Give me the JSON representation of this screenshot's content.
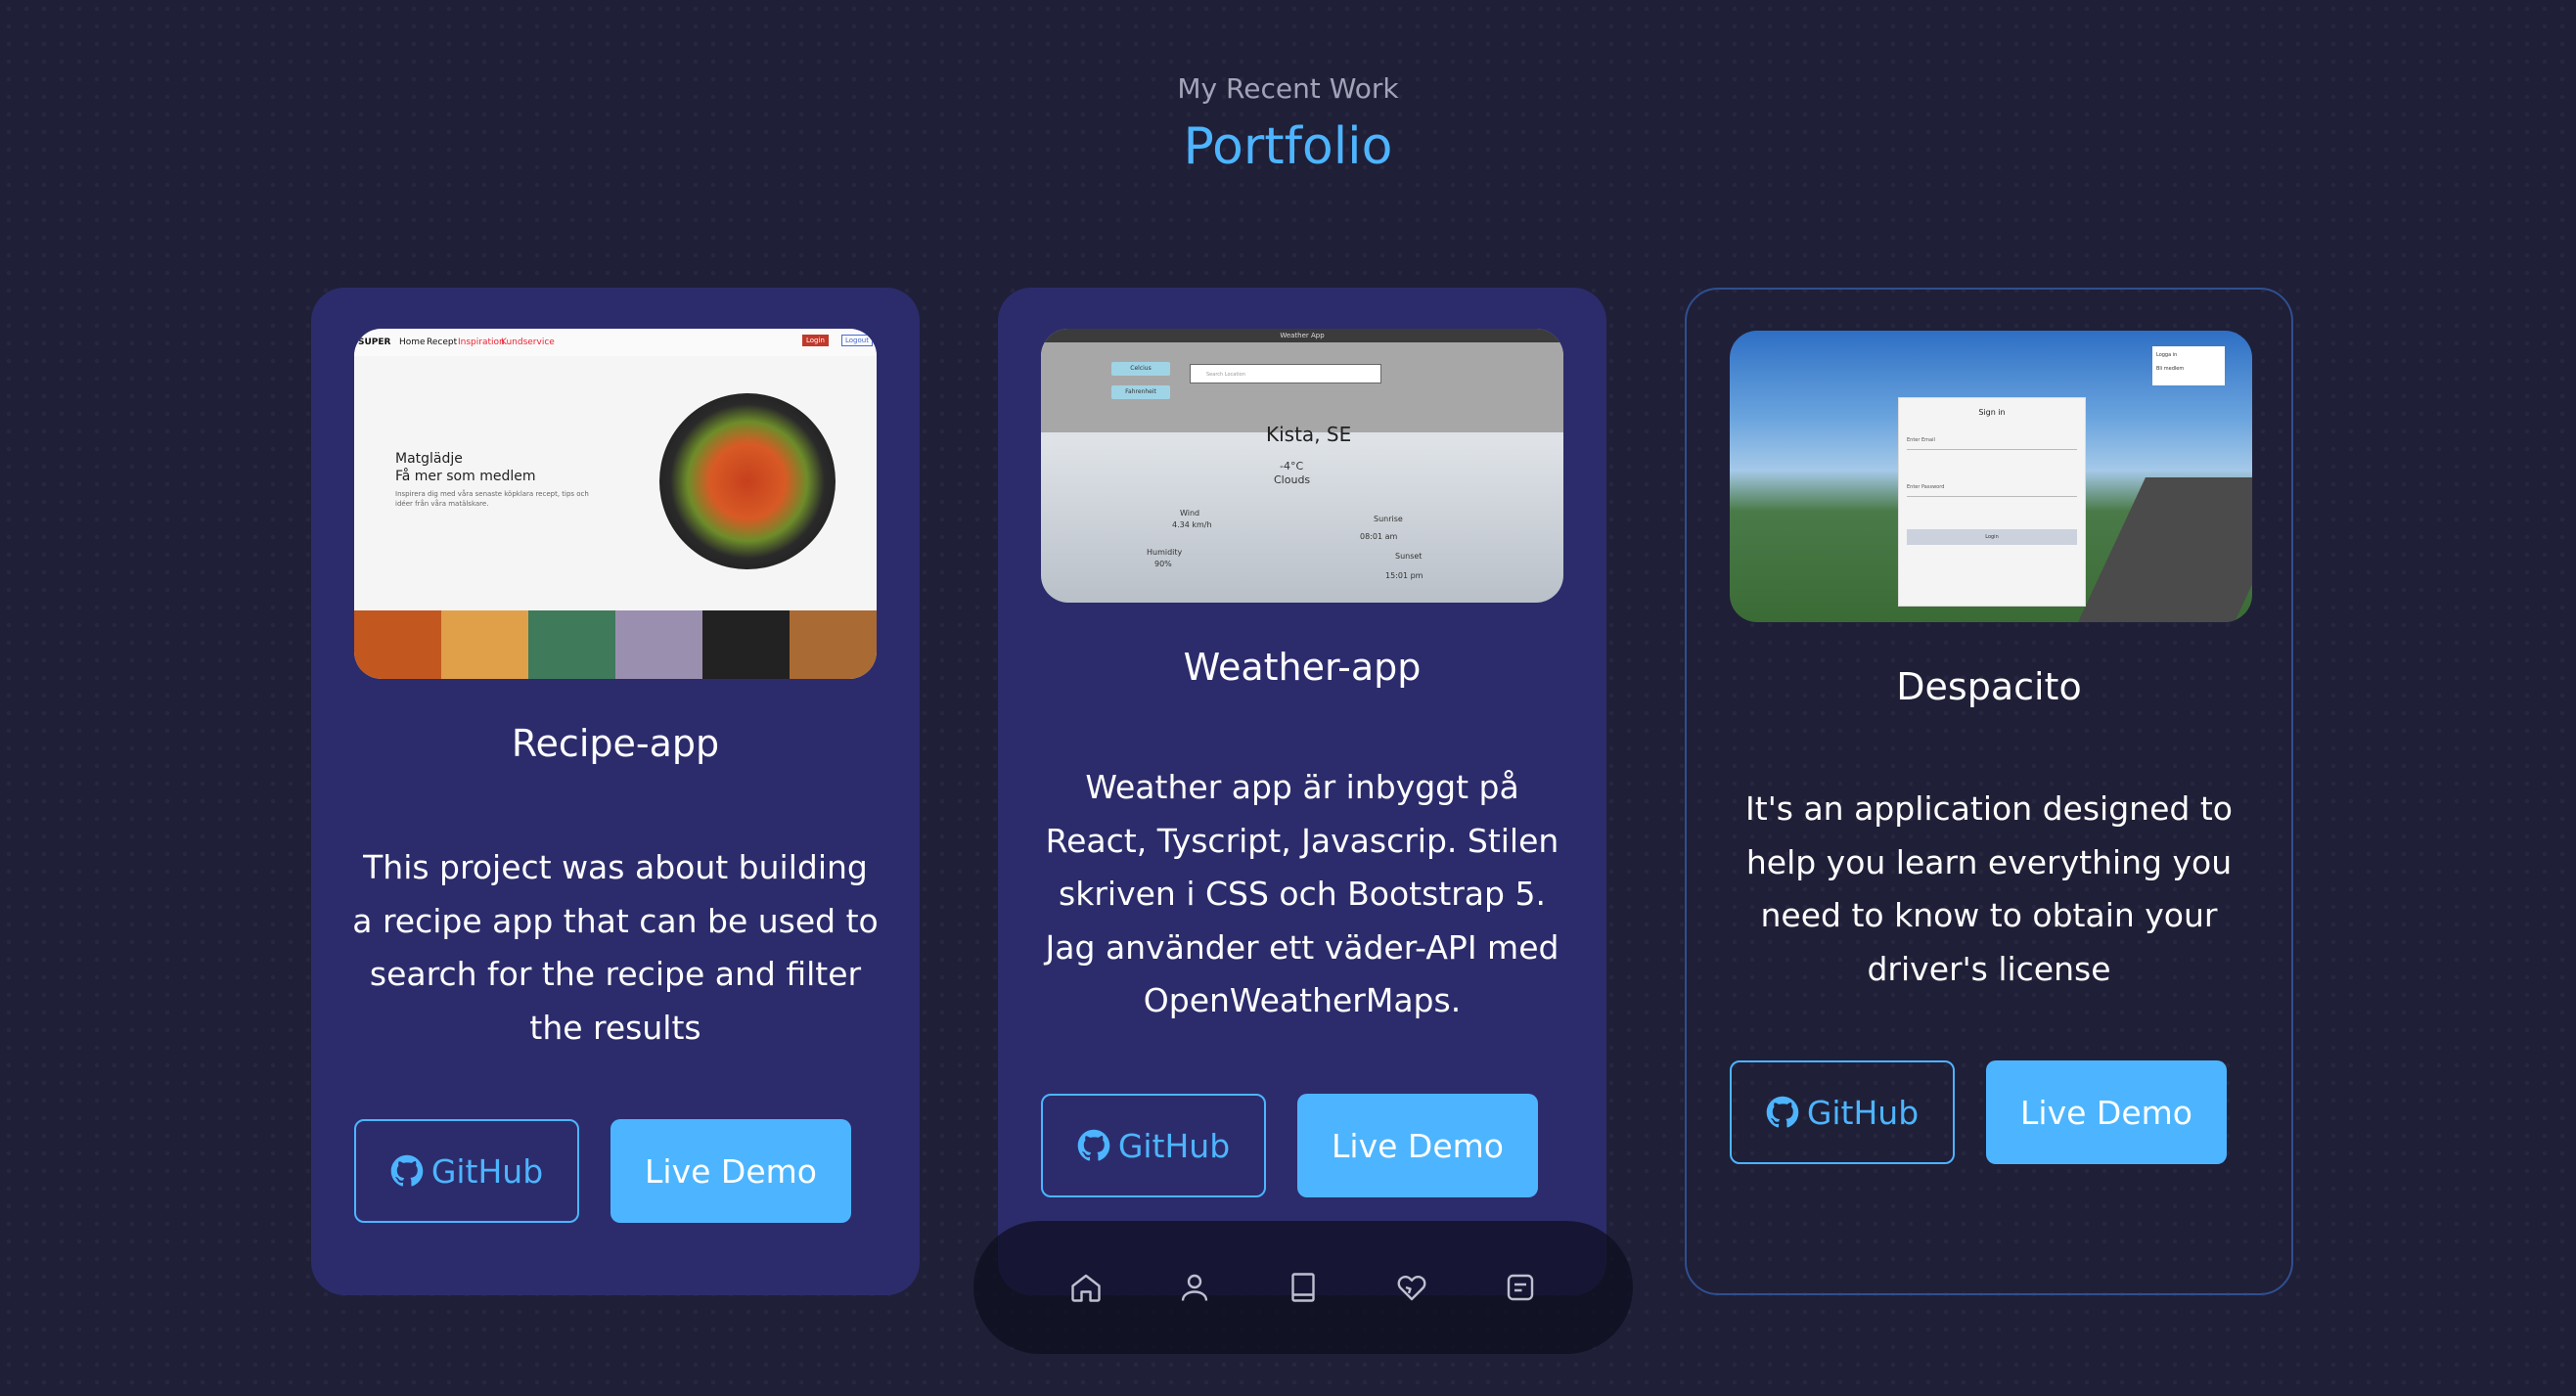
{
  "header": {
    "subtitle": "My Recent Work",
    "title": "Portfolio"
  },
  "projects": [
    {
      "title": "Recipe-app",
      "description": "This project was about building a recipe app that can be used to search for the recipe and filter the results",
      "github_label": "GitHub",
      "demo_label": "Live Demo",
      "preview": {
        "nav_logo": "SUPER",
        "nav_items": [
          "Home",
          "Recept",
          "Inspiration",
          "Kundservice"
        ],
        "login": "Login",
        "logout": "Logout",
        "headline": "Matglädje",
        "subheadline": "Få mer som medlem",
        "body": "Inspirera dig med våra senaste köpklara recept, tips och idéer från våra matälskare."
      }
    },
    {
      "title": "Weather-app",
      "description": "Weather app är inbyggt på React, Tyscript, Javascrip. Stilen skriven i CSS och Bootstrap 5. Jag använder ett väder-API med OpenWeatherMaps.",
      "github_label": "GitHub",
      "demo_label": "Live Demo",
      "preview": {
        "window_title": "Weather App",
        "celsius": "Celcius",
        "fahrenheit": "Fahrenheit",
        "search_placeholder": "Search Location",
        "city": "Kista, SE",
        "temp": "-4°C",
        "condition": "Clouds",
        "wind_label": "Wind",
        "wind_value": "4.34 km/h",
        "humidity_label": "Humidity",
        "humidity_value": "90%",
        "sunrise_label": "Sunrise",
        "sunrise_value": "08:01 am",
        "sunset_label": "Sunset",
        "sunset_value": "15:01 pm"
      }
    },
    {
      "title": "Despacito",
      "description": "It's an application designed to help you learn everything you need to know to obtain your driver's license",
      "github_label": "GitHub",
      "demo_label": "Live Demo",
      "preview": {
        "form_title": "Sign in",
        "email_label": "Enter Email",
        "password_label": "Enter Password",
        "login_button": "Login",
        "box_line1": "Logga in",
        "box_line2": "Bli medlem"
      }
    }
  ],
  "bottom_nav": [
    "home-icon",
    "user-icon",
    "book-icon",
    "heart-icon",
    "message-icon"
  ],
  "colors": {
    "accent": "#4db5ff",
    "card": "#2c2c6c",
    "background": "#1f1f38"
  }
}
